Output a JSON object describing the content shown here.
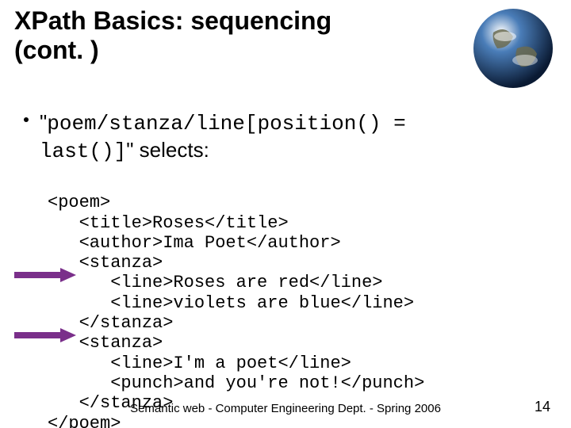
{
  "title_line1": "XPath Basics: sequencing",
  "title_line2": "(cont. )",
  "bullet": {
    "prefix_quote": "\"",
    "xpath": "poem/stanza/line[position() =",
    "xpath_line2": "last()]",
    "suffix": "\" selects:"
  },
  "code": {
    "l1": "<poem>",
    "l2": "   <title>Roses</title>",
    "l3": "   <author>Ima Poet</author>",
    "l4": "   <stanza>",
    "l5": "      <line>Roses are red</line>",
    "l6": "      <line>violets are blue</line>",
    "l7": "   </stanza>",
    "l8": "   <stanza>",
    "l9": "      <line>I'm a poet</line>",
    "l10": "      <punch>and you're not!</punch>",
    "l11": "   </stanza>",
    "l12": "</poem>"
  },
  "footer": "Semantic web - Computer Engineering Dept. - Spring 2006",
  "page_number": "14"
}
